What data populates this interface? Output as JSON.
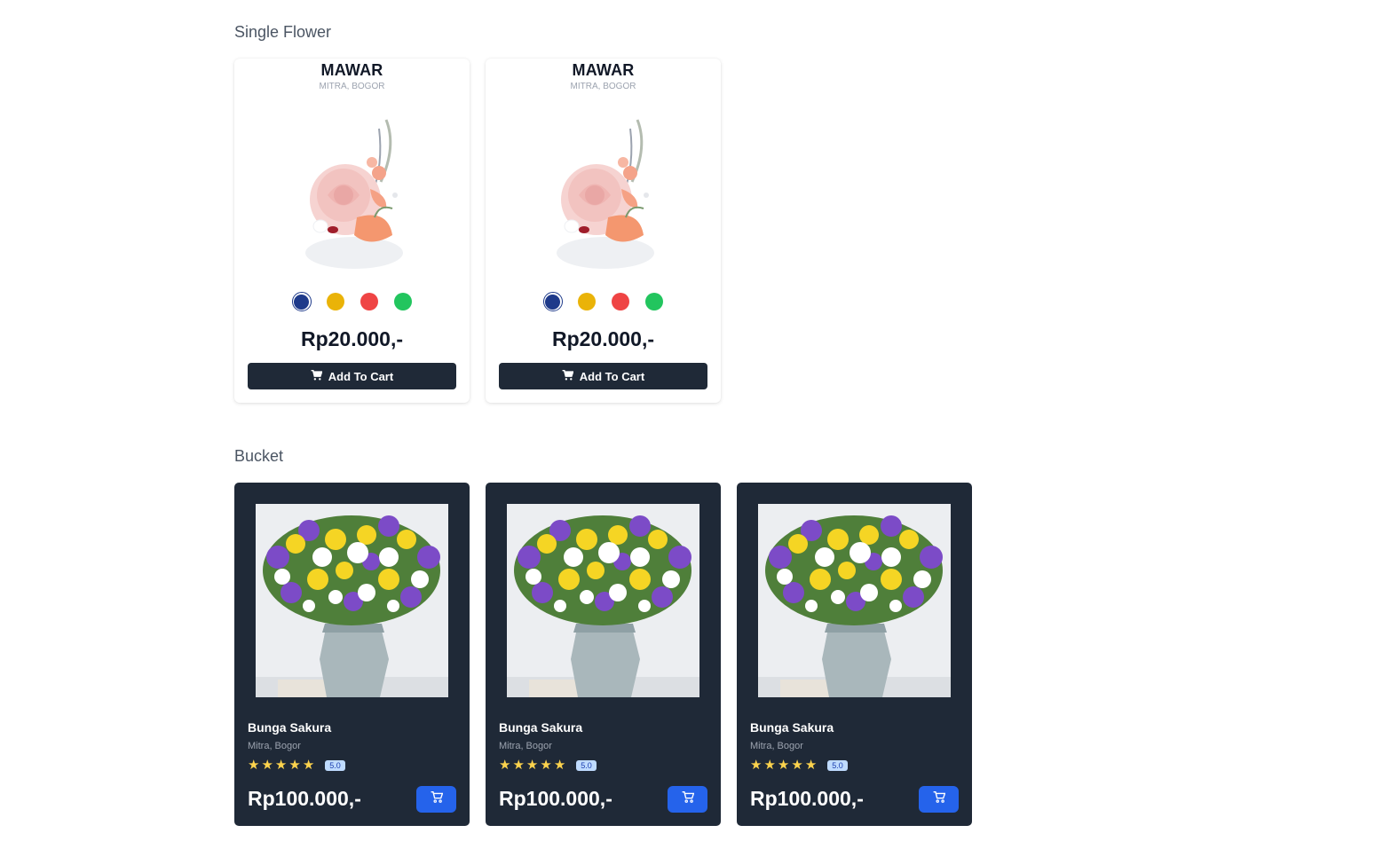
{
  "sections": {
    "single_title": "Single Flower",
    "bucket_title": "Bucket"
  },
  "single": {
    "swatch_colors": [
      "#1e3a8a",
      "#eab308",
      "#ef4444",
      "#22c55e"
    ],
    "items": [
      {
        "name": "MAWAR",
        "location": "MITRA, BOGOR",
        "price": "Rp20.000,-",
        "button": "Add To Cart"
      },
      {
        "name": "MAWAR",
        "location": "MITRA, BOGOR",
        "price": "Rp20.000,-",
        "button": "Add To Cart"
      }
    ]
  },
  "bucket": {
    "items": [
      {
        "name": "Bunga Sakura",
        "location": "Mitra, Bogor",
        "rating": "5.0",
        "stars": 5,
        "price": "Rp100.000,-"
      },
      {
        "name": "Bunga Sakura",
        "location": "Mitra, Bogor",
        "rating": "5.0",
        "stars": 5,
        "price": "Rp100.000,-"
      },
      {
        "name": "Bunga Sakura",
        "location": "Mitra, Bogor",
        "rating": "5.0",
        "stars": 5,
        "price": "Rp100.000,-"
      }
    ]
  }
}
